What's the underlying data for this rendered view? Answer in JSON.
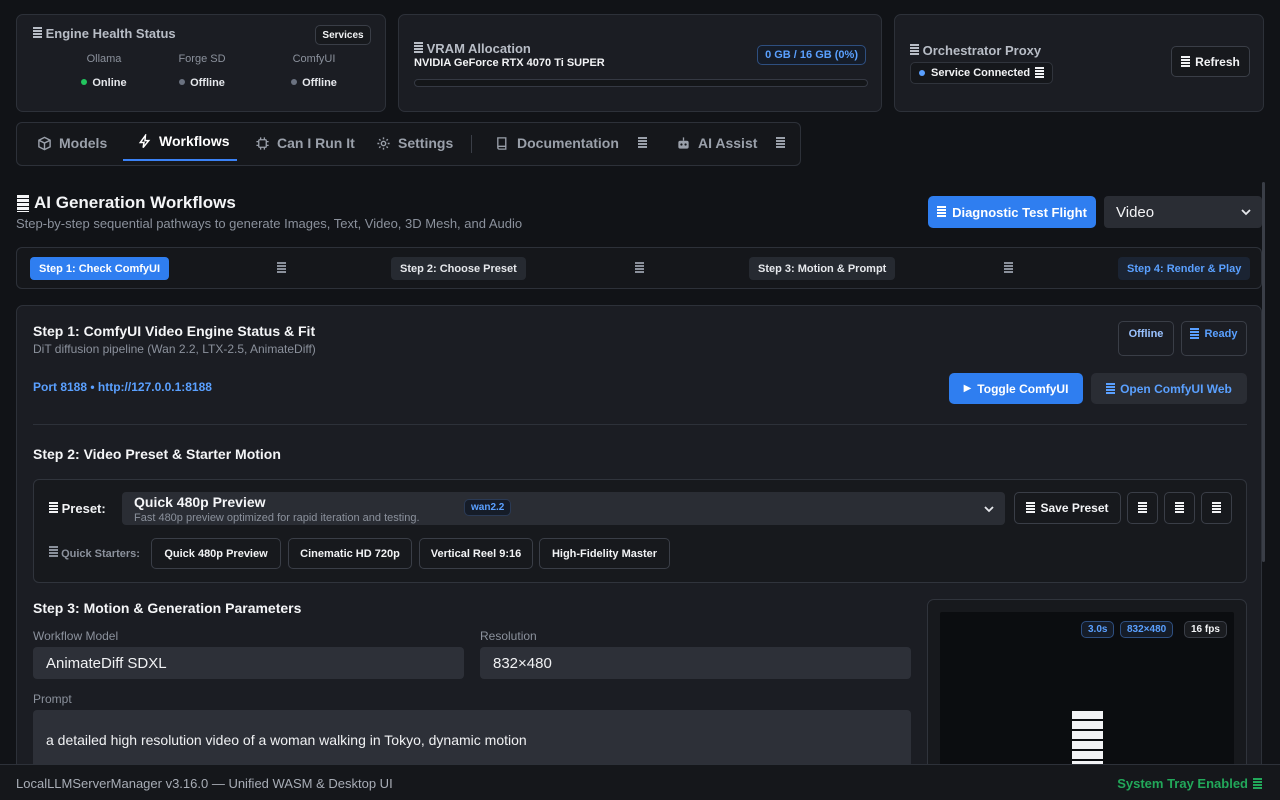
{
  "engine": {
    "title": "Engine Health Status",
    "services_btn": "Services",
    "engines": [
      {
        "name": "Ollama",
        "status": "Online",
        "color": "#22c55e"
      },
      {
        "name": "Forge SD",
        "status": "Offline",
        "color": "#6b7280"
      },
      {
        "name": "ComfyUI",
        "status": "Offline",
        "color": "#6b7280"
      }
    ]
  },
  "vram": {
    "title": "VRAM Allocation",
    "gpu": "NVIDIA GeForce RTX 4070 Ti SUPER",
    "usage": "0 GB / 16 GB (0%)",
    "fraction": 0
  },
  "proxy": {
    "title": "Orchestrator Proxy",
    "status": "Service Connected",
    "refresh": "Refresh"
  },
  "nav": {
    "tabs": [
      {
        "label": "Models",
        "icon": "cube-icon"
      },
      {
        "label": "Workflows",
        "icon": "lightning-icon"
      },
      {
        "label": "Can I Run It",
        "icon": "chip-icon"
      },
      {
        "label": "Settings",
        "icon": "gear-icon"
      },
      {
        "label": "Documentation",
        "icon": "book-icon"
      },
      {
        "label": "AI Assist",
        "icon": "robot-icon"
      }
    ],
    "active": "Workflows"
  },
  "header": {
    "title": "AI Generation Workflows",
    "subtitle": "Step-by-step sequential pathways to generate Images, Text, Video, 3D Mesh, and Audio",
    "diag_btn": "Diagnostic Test Flight",
    "mode": "Video"
  },
  "stepper": [
    "Step 1: Check ComfyUI",
    "Step 2: Choose Preset",
    "Step 3: Motion & Prompt",
    "Step 4: Render & Play"
  ],
  "step1": {
    "title": "Step 1: ComfyUI Video Engine Status & Fit",
    "subtitle": "DiT diffusion pipeline (Wan 2.2, LTX-2.5, AnimateDiff)",
    "offline": "Offline",
    "ready": "Ready",
    "port": "Port 8188 • http://127.0.0.1:8188",
    "toggle": "Toggle ComfyUI",
    "open_web": "Open ComfyUI Web"
  },
  "step2": {
    "title": "Step 2: Video Preset & Starter Motion",
    "preset_label": "Preset:",
    "preset_name": "Quick 480p Preview",
    "preset_desc": "Fast 480p preview optimized for rapid iteration and testing.",
    "preset_tag": "wan2.2",
    "save": "Save Preset",
    "quick_label": "Quick Starters:",
    "starters": [
      "Quick 480p Preview",
      "Cinematic HD 720p",
      "Vertical Reel 9:16",
      "High-Fidelity Master"
    ]
  },
  "step3": {
    "title": "Step 3: Motion & Generation Parameters",
    "model_label": "Workflow Model",
    "model": "AnimateDiff SDXL",
    "res_label": "Resolution",
    "res": "832×480",
    "prompt_label": "Prompt",
    "prompt": "a detailed high resolution video of a woman walking in Tokyo, dynamic motion"
  },
  "preview": {
    "duration": "3.0s",
    "res": "832×480",
    "fps": "16 fps"
  },
  "footer": {
    "version": "LocalLLMServerManager v3.16.0 — Unified WASM & Desktop UI",
    "tray": "System Tray Enabled"
  },
  "colors": {
    "accent": "#2f7ef0",
    "background": "#111317",
    "panel": "#1b1d23",
    "online": "#22c55e",
    "tray": "#22a85a"
  }
}
